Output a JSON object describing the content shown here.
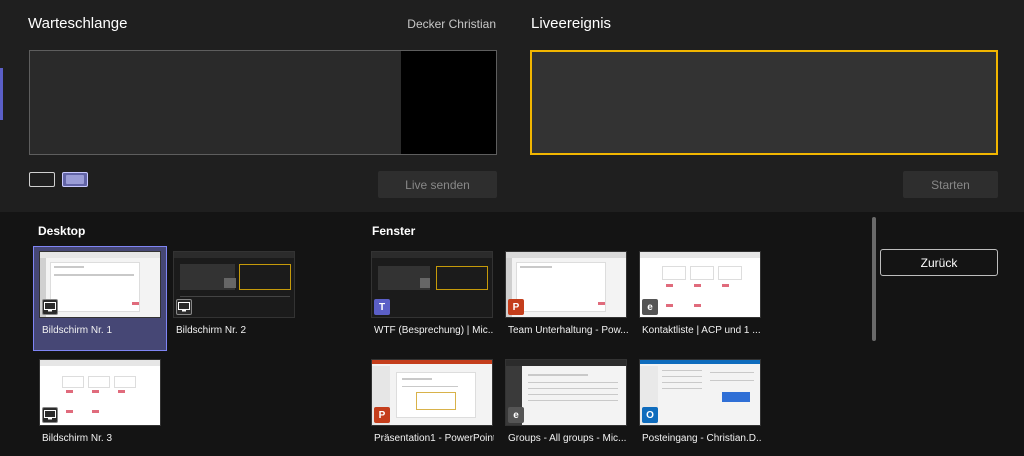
{
  "queue": {
    "title": "Warteschlange",
    "presenter": "Decker Christian"
  },
  "live": {
    "title": "Liveereignis"
  },
  "buttons": {
    "send_live": "Live senden",
    "start": "Starten",
    "back": "Zurück"
  },
  "sections": {
    "desktop": "Desktop",
    "windows": "Fenster"
  },
  "desktops": [
    {
      "label": "Bildschirm Nr. 1",
      "icon": "screen-share-icon",
      "selected": true
    },
    {
      "label": "Bildschirm Nr. 2",
      "icon": "screen-share-icon",
      "selected": false
    },
    {
      "label": "Bildschirm Nr. 3",
      "icon": "screen-share-icon",
      "selected": false
    }
  ],
  "windows": [
    {
      "label": "WTF (Besprechung) | Mic...",
      "icon": "teams-icon"
    },
    {
      "label": "Team Unterhaltung - Pow...",
      "icon": "powerpoint-icon"
    },
    {
      "label": "Kontaktliste | ACP und 1 ...",
      "icon": "edge-icon"
    },
    {
      "label": "Präsentation1 - PowerPoint",
      "icon": "powerpoint-icon"
    },
    {
      "label": "Groups - All groups - Mic...",
      "icon": "edge-icon"
    },
    {
      "label": "Posteingang - Christian.D...",
      "icon": "outlook-icon"
    }
  ],
  "colors": {
    "accent": "#6264a7",
    "live_border": "#f2b600",
    "background": "#1f1f1f"
  }
}
